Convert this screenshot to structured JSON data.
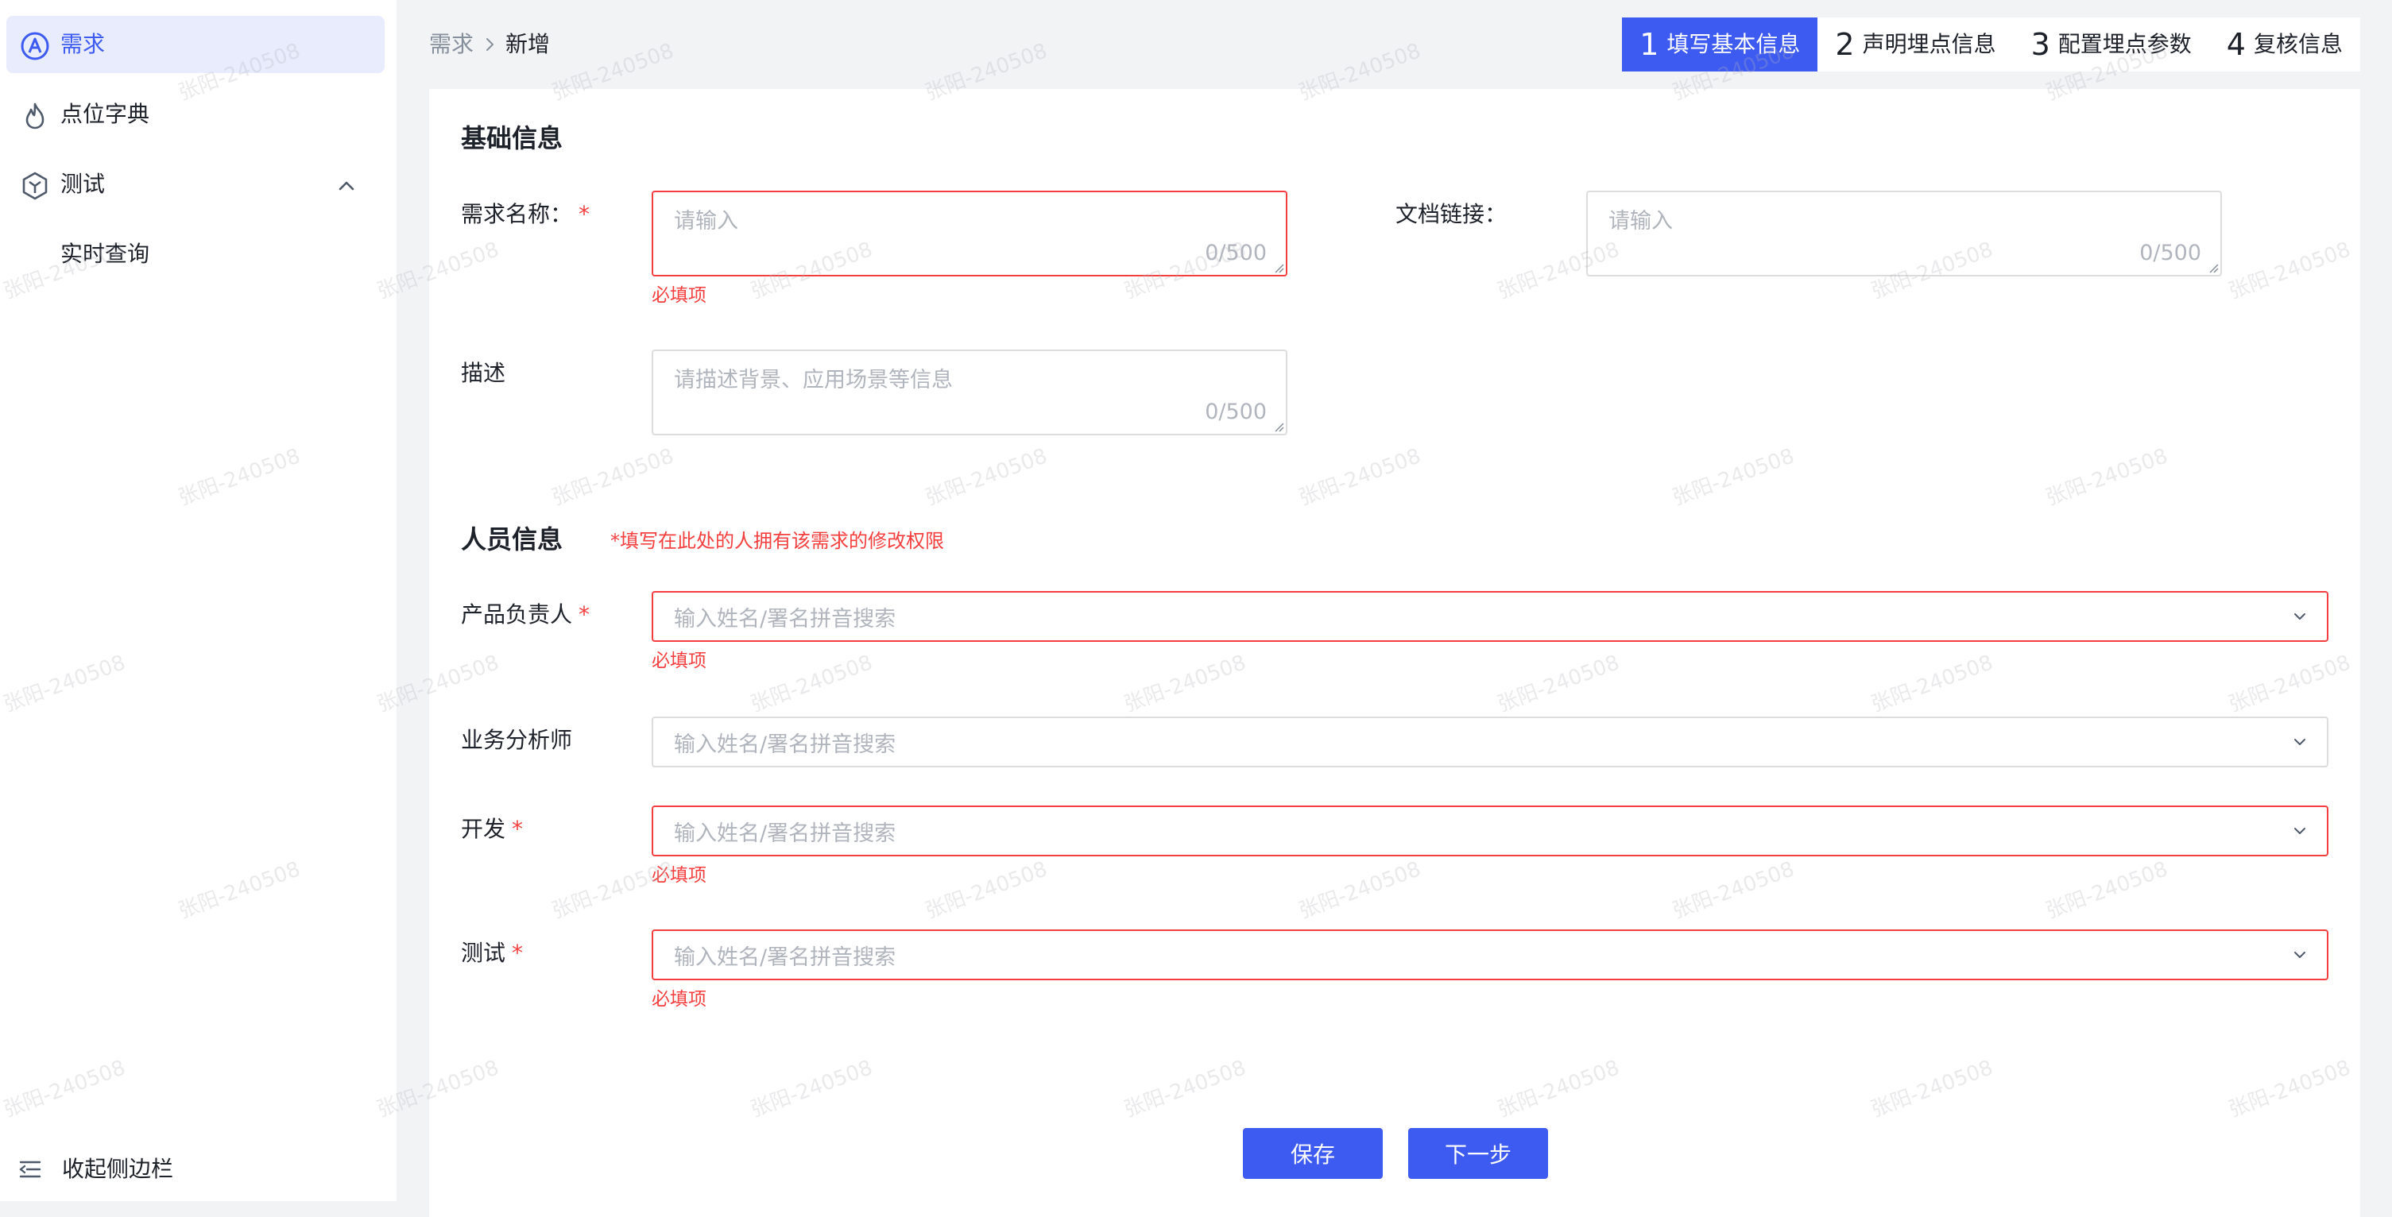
{
  "sidebar": {
    "items": [
      {
        "label": "需求",
        "icon": "letter-a-circle-icon",
        "active": true
      },
      {
        "label": "点位字典",
        "icon": "flame-icon"
      },
      {
        "label": "测试",
        "icon": "hexagon-cube-icon",
        "expanded": true
      }
    ],
    "sub_items": [
      {
        "label": "实时查询"
      }
    ],
    "collapse_label": "收起侧边栏"
  },
  "breadcrumb": {
    "parent": "需求",
    "current": "新增"
  },
  "steps": [
    {
      "num": "1",
      "label": "填写基本信息",
      "active": true
    },
    {
      "num": "2",
      "label": "声明埋点信息"
    },
    {
      "num": "3",
      "label": "配置埋点参数"
    },
    {
      "num": "4",
      "label": "复核信息"
    }
  ],
  "basic_info": {
    "title": "基础信息",
    "name": {
      "label": "需求名称：",
      "placeholder": "请输入",
      "counter": "0/500",
      "error": "必填项"
    },
    "doc_link": {
      "label": "文档链接：",
      "placeholder": "请输入",
      "counter": "0/500"
    },
    "description": {
      "label": "描述",
      "placeholder": "请描述背景、应用场景等信息",
      "counter": "0/500"
    }
  },
  "personnel": {
    "title": "人员信息",
    "note": "*填写在此处的人拥有该需求的修改权限",
    "fields": [
      {
        "label": "产品负责人",
        "placeholder": "输入姓名/署名拼音搜索",
        "required": true,
        "error": "必填项"
      },
      {
        "label": "业务分析师",
        "placeholder": "输入姓名/署名拼音搜索"
      },
      {
        "label": "开发",
        "placeholder": "输入姓名/署名拼音搜索",
        "required": true,
        "error": "必填项"
      },
      {
        "label": "测试",
        "placeholder": "输入姓名/署名拼音搜索",
        "required": true,
        "error": "必填项"
      }
    ]
  },
  "required_mark": "*",
  "actions": {
    "save": "保存",
    "next": "下一步"
  },
  "watermark": "张阳-240508",
  "colors": {
    "primary": "#3d5af1",
    "error": "#f53f3f",
    "active_bg": "#e8ecfd"
  }
}
